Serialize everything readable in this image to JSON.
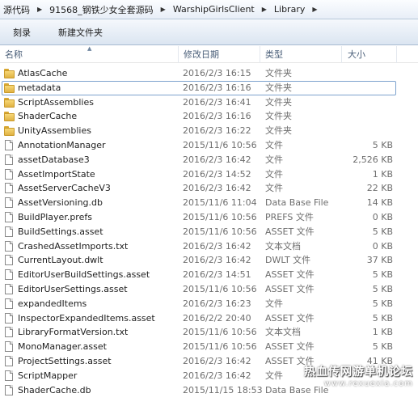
{
  "breadcrumb": [
    "源代码",
    "91568_钢铁少女全套源码",
    "WarshipGirlsClient",
    "Library"
  ],
  "toolbar": {
    "burn_label": "刻录",
    "new_folder_label": "新建文件夹"
  },
  "columns": {
    "name": "名称",
    "date": "修改日期",
    "type": "类型",
    "size": "大小"
  },
  "files": [
    {
      "name": "AtlasCache",
      "date": "2016/2/3 16:15",
      "type": "文件夹",
      "size": "",
      "icon": "folder-icon"
    },
    {
      "name": "metadata",
      "date": "2016/2/3 16:16",
      "type": "文件夹",
      "size": "",
      "icon": "folder-icon",
      "selected": true
    },
    {
      "name": "ScriptAssemblies",
      "date": "2016/2/3 16:41",
      "type": "文件夹",
      "size": "",
      "icon": "folder-icon"
    },
    {
      "name": "ShaderCache",
      "date": "2016/2/3 16:16",
      "type": "文件夹",
      "size": "",
      "icon": "folder-icon"
    },
    {
      "name": "UnityAssemblies",
      "date": "2016/2/3 16:22",
      "type": "文件夹",
      "size": "",
      "icon": "folder-icon"
    },
    {
      "name": "AnnotationManager",
      "date": "2015/11/6 10:56",
      "type": "文件",
      "size": "5 KB",
      "icon": "file-icon"
    },
    {
      "name": "assetDatabase3",
      "date": "2016/2/3 16:42",
      "type": "文件",
      "size": "2,526 KB",
      "icon": "file-icon"
    },
    {
      "name": "AssetImportState",
      "date": "2016/2/3 14:52",
      "type": "文件",
      "size": "1 KB",
      "icon": "file-icon"
    },
    {
      "name": "AssetServerCacheV3",
      "date": "2016/2/3 16:42",
      "type": "文件",
      "size": "22 KB",
      "icon": "file-icon"
    },
    {
      "name": "AssetVersioning.db",
      "date": "2015/11/6 11:04",
      "type": "Data Base File",
      "size": "14 KB",
      "icon": "file-icon"
    },
    {
      "name": "BuildPlayer.prefs",
      "date": "2015/11/6 10:56",
      "type": "PREFS 文件",
      "size": "0 KB",
      "icon": "file-icon"
    },
    {
      "name": "BuildSettings.asset",
      "date": "2015/11/6 10:56",
      "type": "ASSET 文件",
      "size": "5 KB",
      "icon": "file-icon"
    },
    {
      "name": "CrashedAssetImports.txt",
      "date": "2016/2/3 16:42",
      "type": "文本文档",
      "size": "0 KB",
      "icon": "file-icon"
    },
    {
      "name": "CurrentLayout.dwlt",
      "date": "2016/2/3 16:42",
      "type": "DWLT 文件",
      "size": "37 KB",
      "icon": "file-icon"
    },
    {
      "name": "EditorUserBuildSettings.asset",
      "date": "2016/2/3 14:51",
      "type": "ASSET 文件",
      "size": "5 KB",
      "icon": "file-icon"
    },
    {
      "name": "EditorUserSettings.asset",
      "date": "2015/11/6 10:56",
      "type": "ASSET 文件",
      "size": "5 KB",
      "icon": "file-icon"
    },
    {
      "name": "expandedItems",
      "date": "2016/2/3 16:23",
      "type": "文件",
      "size": "5 KB",
      "icon": "file-icon"
    },
    {
      "name": "InspectorExpandedItems.asset",
      "date": "2016/2/2 20:40",
      "type": "ASSET 文件",
      "size": "5 KB",
      "icon": "file-icon"
    },
    {
      "name": "LibraryFormatVersion.txt",
      "date": "2015/11/6 10:56",
      "type": "文本文档",
      "size": "1 KB",
      "icon": "file-icon"
    },
    {
      "name": "MonoManager.asset",
      "date": "2015/11/6 10:56",
      "type": "ASSET 文件",
      "size": "5 KB",
      "icon": "file-icon"
    },
    {
      "name": "ProjectSettings.asset",
      "date": "2016/2/3 16:42",
      "type": "ASSET 文件",
      "size": "41 KB",
      "icon": "file-icon"
    },
    {
      "name": "ScriptMapper",
      "date": "2016/2/3 16:42",
      "type": "文件",
      "size": "",
      "icon": "file-icon"
    },
    {
      "name": "ShaderCache.db",
      "date": "2015/11/15 18:53",
      "type": "Data Base File",
      "size": "",
      "icon": "file-icon"
    }
  ],
  "watermark": {
    "title": "热血传网游单机论坛",
    "url": "www.rexuexia.com"
  }
}
